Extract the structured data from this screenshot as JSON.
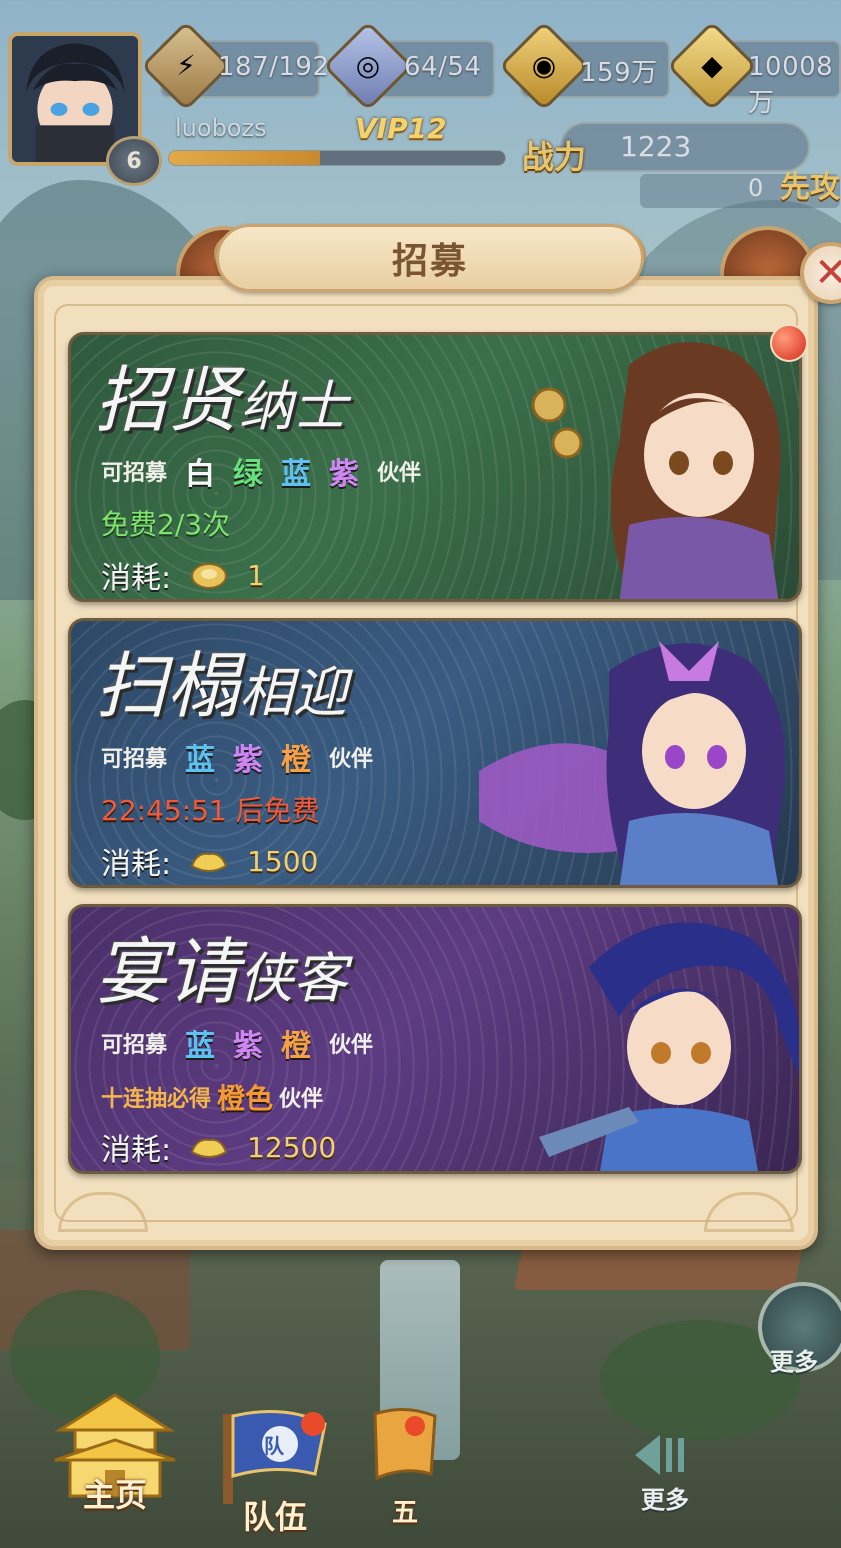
{
  "hud": {
    "stamina": "187/192",
    "spirit": "64/54",
    "coins": "159万",
    "ingots": "10008万",
    "username": "luobozs",
    "vip": "VIP12",
    "level": "6",
    "exp_progress": 0.45,
    "power_label": "战力",
    "power_value": "1223",
    "first_value": "0",
    "first_label": "先攻"
  },
  "panel": {
    "title": "招募",
    "close_symbol": "✕"
  },
  "cards": [
    {
      "title_big": "招贤",
      "title_small": "纳士",
      "recruit_label": "可招募",
      "qualities": [
        "白",
        "绿",
        "蓝",
        "紫"
      ],
      "partner_label": "伙伴",
      "status": "免费2/3次",
      "cost_label": "消耗:",
      "cost_value": "1"
    },
    {
      "title_big": "扫榻",
      "title_small": "相迎",
      "recruit_label": "可招募",
      "qualities": [
        "蓝",
        "紫",
        "橙"
      ],
      "partner_label": "伙伴",
      "status": "22:45:51 后免费",
      "cost_label": "消耗:",
      "cost_value": "1500"
    },
    {
      "title_big": "宴请",
      "title_small": "侠客",
      "recruit_label": "可招募",
      "qualities": [
        "蓝",
        "紫",
        "橙"
      ],
      "partner_label": "伙伴",
      "ten_pull_prefix": "十连抽必得",
      "ten_pull_quality": "橙色",
      "ten_pull_suffix": "伙伴",
      "cost_label": "消耗:",
      "cost_value": "12500"
    }
  ],
  "nav": {
    "home": "主页",
    "team": "队伍",
    "five": "五",
    "more": "更多",
    "more2": "更多",
    "team_badge": "队"
  },
  "colors": {
    "panel_bg": "#f1dfbe",
    "quality_green": "#66e07b",
    "quality_blue": "#5ec1f0",
    "quality_purple": "#cf86f2",
    "quality_orange": "#f3a048",
    "free_text": "#7fe36f",
    "timer_text": "#f05a3a"
  }
}
